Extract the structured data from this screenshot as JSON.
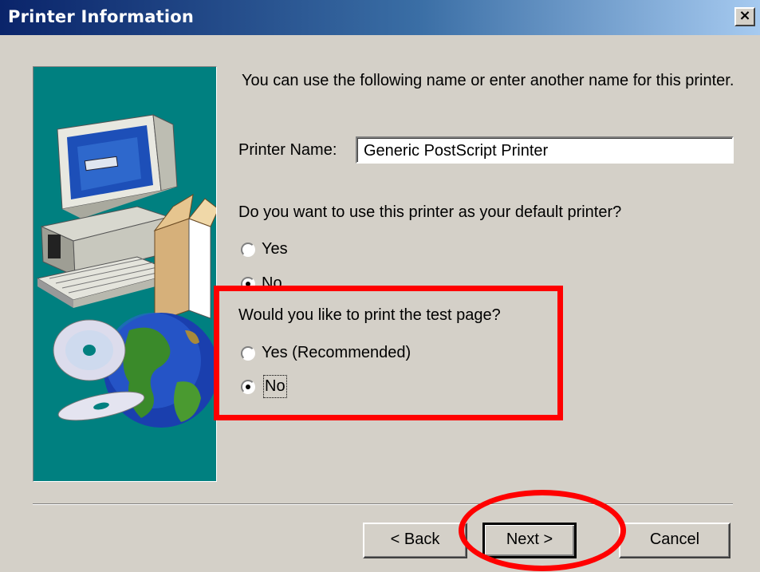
{
  "window": {
    "title": "Printer Information",
    "close_label": "×"
  },
  "intro_text": "You can use the following name or enter another name for this printer.",
  "printer_name": {
    "label": "Printer Name:",
    "value": "Generic PostScript Printer"
  },
  "default_printer": {
    "question": "Do you want to use this printer as your default printer?",
    "options": [
      {
        "label": "Yes",
        "selected": false
      },
      {
        "label": "No",
        "selected": true
      }
    ]
  },
  "test_page": {
    "question": "Would you like to print the test page?",
    "options": [
      {
        "label": "Yes (Recommended)",
        "selected": false
      },
      {
        "label": "No",
        "selected": true
      }
    ]
  },
  "buttons": {
    "back": "< Back",
    "next": "Next >",
    "cancel": "Cancel"
  },
  "colors": {
    "highlight": "#ff0000",
    "artwork_bg": "#008080",
    "dialog_bg": "#d4d0c8"
  }
}
